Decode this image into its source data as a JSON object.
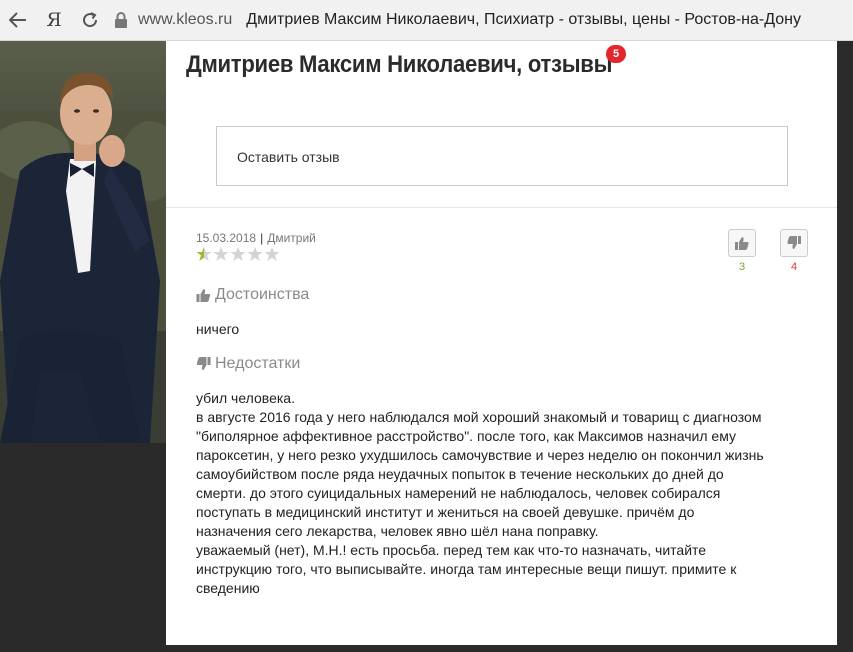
{
  "browser": {
    "domain": "www.kleos.ru",
    "title": "Дмитриев Максим Николаевич, Психиатр - отзывы, цены - Ростов-на-Дону",
    "yandex_label": "Я"
  },
  "page": {
    "heading": "Дмитриев Максим Николаевич, отзывы",
    "badge_count": "5",
    "leave_review": "Оставить отзыв"
  },
  "review": {
    "date": "15.03.2018",
    "separator": "|",
    "author": "Дмитрий",
    "rating": 0.5,
    "rating_max": 5,
    "likes": "3",
    "dislikes": "4",
    "pros_heading": "Достоинства",
    "pros_text": "ничего",
    "cons_heading": "Недостатки",
    "cons_lines": [
      "убил человека.",
      "в августе 2016 года у него наблюдался мой хороший знакомый и товарищ с диагнозом",
      "\"биполярное аффективное расстройство\". после того, как Максимов назначил ему",
      "пароксетин, у него резко ухудшилось самочувствие и через неделю он покончил жизнь",
      "самоубийством после ряда неудачных попыток в течение нескольких до дней до",
      "смерти. до этого суицидальных намерений не наблюдалось, человек собирался",
      "поступать в медицинский институт и жениться на своей девушке. причём до",
      "назначения сего лекарства, человек явно шёл нана поправку.",
      "уважаемый (нет), М.Н.! есть просьба. перед тем как что-то назначать, читайте",
      "инструкцию того, что выписывайте. иногда там интересные вещи пишут. примите к",
      "сведению"
    ]
  },
  "colors": {
    "badge": "#e3262b",
    "likes": "#7aa03a",
    "dislikes": "#d53a3a",
    "star_filled": "#a8b33a",
    "star_empty": "#d4d4d4"
  }
}
